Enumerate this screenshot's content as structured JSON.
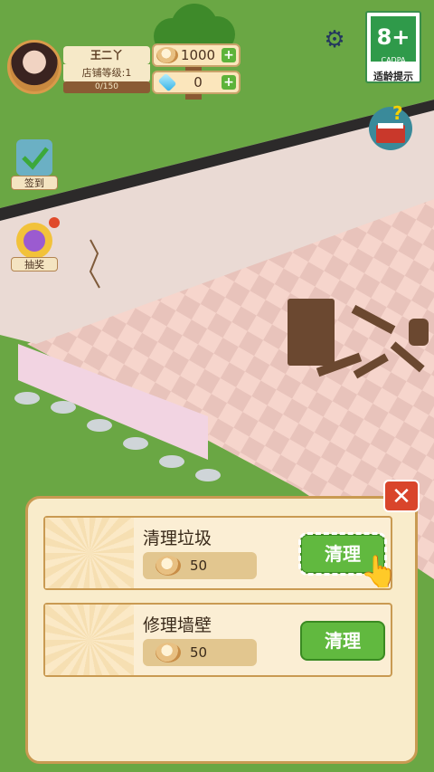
{
  "player": {
    "name": "王二丫",
    "level": "店铺等级:1",
    "exp": "0/150"
  },
  "resources": {
    "coins": "1000",
    "gems": "0",
    "plus": "+"
  },
  "cadpa": {
    "age": "8+",
    "org": "CADPA",
    "tip": "适龄提示"
  },
  "side": {
    "checkin": "签到",
    "lottery": "抽奖"
  },
  "tasks": {
    "close": "✕",
    "items": [
      {
        "name": "清理垃圾",
        "cost": "50",
        "action": "清理"
      },
      {
        "name": "修理墙壁",
        "cost": "50",
        "action": "清理"
      }
    ]
  },
  "icons": [
    "gear-icon",
    "help-book-icon",
    "coin-icon",
    "gem-icon",
    "checkin-icon",
    "lottery-wheel-icon",
    "pointer-hand-icon"
  ]
}
